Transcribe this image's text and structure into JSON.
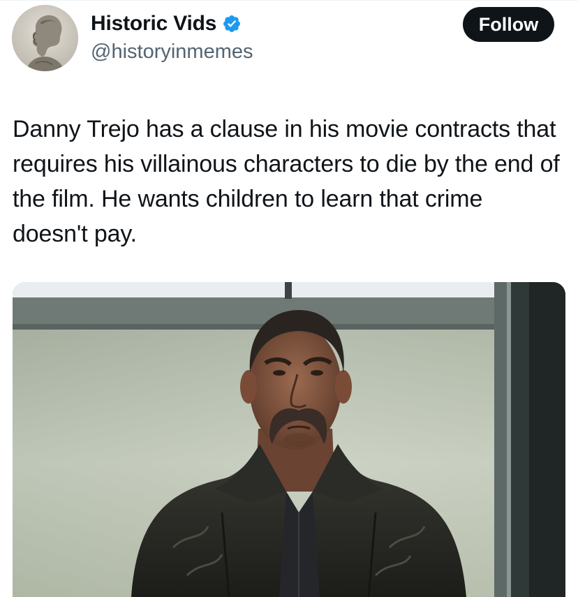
{
  "post": {
    "author": {
      "display_name": "Historic Vids",
      "handle": "@historyinmemes",
      "verified": true,
      "avatar_icon": "bust-portrait-icon"
    },
    "follow_label": "Follow",
    "text": "Danny Trejo has a clause in his movie contracts that requires his villainous characters to die by the end of the film. He wants children to learn that crime doesn't pay.",
    "media": {
      "type": "photo",
      "subject": "man-in-leather-jacket-photo"
    }
  },
  "colors": {
    "text_primary": "#0f1419",
    "text_secondary": "#536471",
    "verified_blue": "#1d9bf0",
    "follow_button_bg": "#0f1419",
    "follow_button_text": "#ffffff"
  }
}
